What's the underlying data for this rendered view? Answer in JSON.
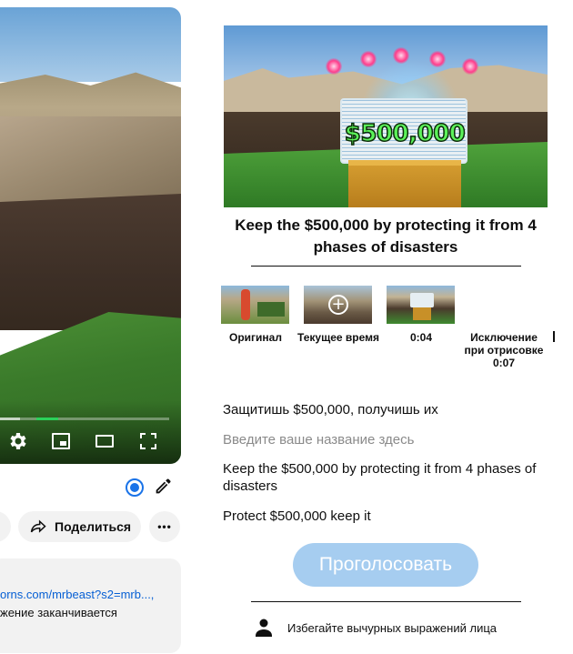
{
  "player": {
    "controls": [
      "settings-icon",
      "miniplayer-icon",
      "theater-mode-icon",
      "fullscreen-icon"
    ],
    "progress_fraction": 0.12,
    "chapter_color": "#2bd15a"
  },
  "actions": {
    "share_label": "Поделиться",
    "more_label": "•••",
    "edit_icon": "pencil-icon",
    "status_icon": "radio-icon"
  },
  "description": {
    "link_text": "orns.com/mrbeast?s2=mrb...,",
    "line2": "жение заканчивается"
  },
  "panel": {
    "thumbnail_price": "$500,000",
    "title": "Keep the $500,000 by protecting it from 4 phases of disasters",
    "frames": [
      {
        "label": "Оригинал"
      },
      {
        "label": "Текущее время"
      },
      {
        "label": "0:04"
      },
      {
        "label": "Исключение при отрисовке 0:07"
      }
    ],
    "options": [
      "Защитишь $500,000, получишь их",
      "Введите ваше название здесь",
      "Keep the $500,000 by protecting it from 4 phases of disasters",
      "Protect $500,000 keep it"
    ],
    "vote_label": "Проголосовать",
    "hint_text": "Избегайте вычурных выражений лица",
    "hint_icon": "person-icon",
    "accent_color": "#a6cdf0",
    "link_color": "#065fd4"
  }
}
